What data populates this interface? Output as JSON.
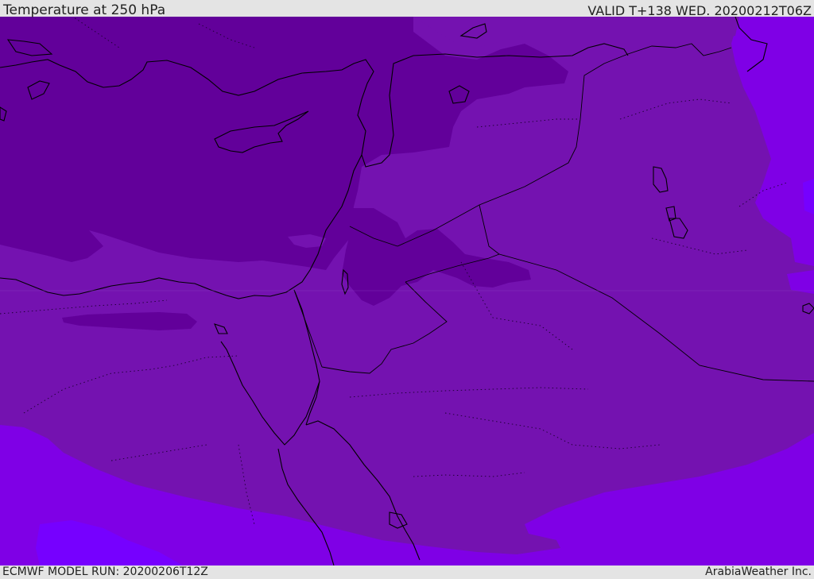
{
  "header": {
    "title": "Temperature at 250 hPa",
    "valid_time": "VALID T+138 WED. 20200212T06Z"
  },
  "footer": {
    "model_run": "ECMWF MODEL RUN: 20200206T12Z",
    "credit": "ArabiaWeather Inc."
  },
  "map": {
    "layer": "temperature-250hpa",
    "colors": {
      "coldest_dark": "#62009a",
      "cold_mid": "#7412b0",
      "cool_band": "#7a16b4",
      "lighter_violet": "#7f00e6",
      "lightest_violet": "#7600ff",
      "coastline": "#000000"
    }
  }
}
